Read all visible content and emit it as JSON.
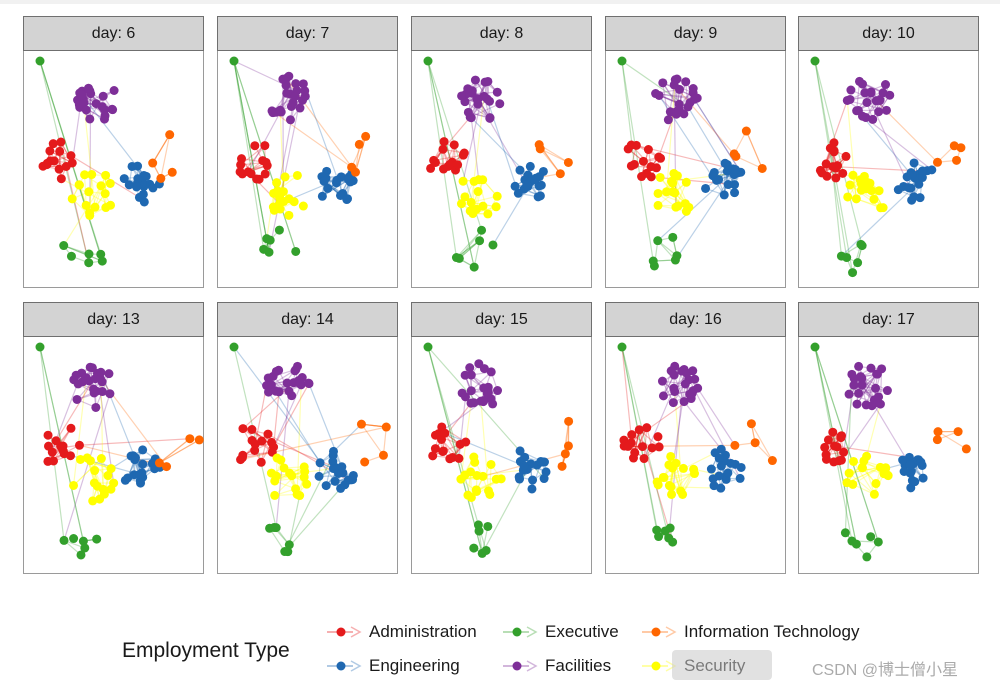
{
  "panels": [
    {
      "label": "day: 6"
    },
    {
      "label": "day: 7"
    },
    {
      "label": "day: 8"
    },
    {
      "label": "day: 9"
    },
    {
      "label": "day: 10"
    },
    {
      "label": "day: 13"
    },
    {
      "label": "day: 14"
    },
    {
      "label": "day: 15"
    },
    {
      "label": "day: 16"
    },
    {
      "label": "day: 17"
    }
  ],
  "legend": {
    "title": "Employment Type",
    "items": [
      {
        "label": "Administration",
        "color": "#e41a1c"
      },
      {
        "label": "Executive",
        "color": "#33a02c"
      },
      {
        "label": "Information Technology",
        "color": "#ff6600"
      },
      {
        "label": "Engineering",
        "color": "#1f68b1"
      },
      {
        "label": "Facilities",
        "color": "#7e2f98"
      },
      {
        "label": "Security",
        "color": "#ffff00"
      }
    ]
  },
  "watermark": "CSDN @博士僧小星"
}
